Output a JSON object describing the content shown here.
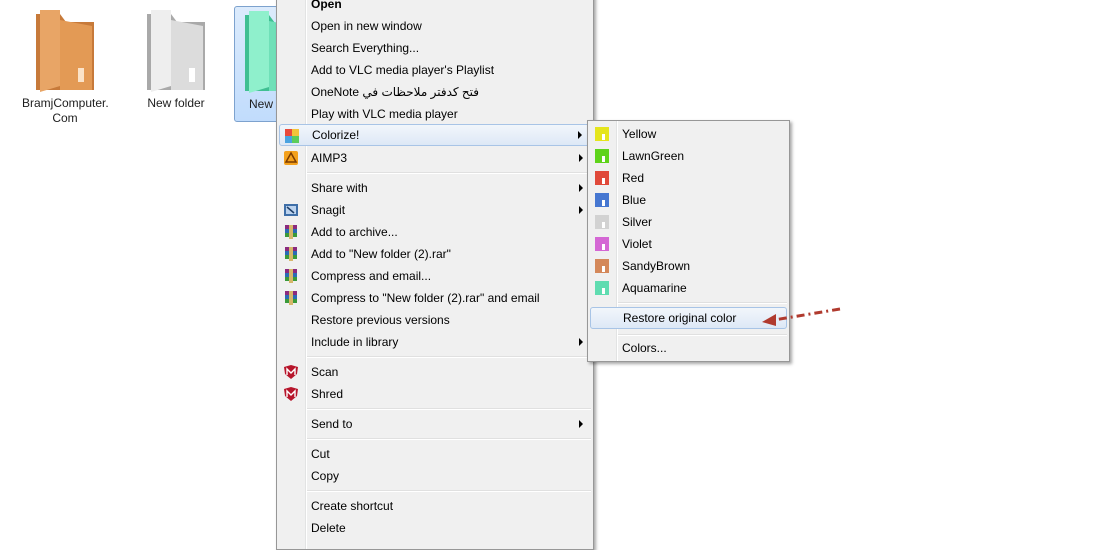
{
  "desktop": {
    "items": [
      {
        "label": "BramjComputer.\nCom",
        "color": "#d9904e"
      },
      {
        "label": "New folder",
        "color": "#d8d8d8"
      },
      {
        "label": "New",
        "color": "#6fe0b8"
      }
    ]
  },
  "context_menu": {
    "items": [
      {
        "label": "Open"
      },
      {
        "label": "Open in new window"
      },
      {
        "label": "Search Everything..."
      },
      {
        "label": "Add to VLC media player's Playlist"
      },
      {
        "label": "OneNote فتح كدفتر ملاحظات في"
      },
      {
        "label": "Play with VLC media player"
      },
      {
        "label": "Colorize!",
        "icon": "colorize-icon"
      },
      {
        "label": "AIMP3",
        "icon": "aimp-icon"
      },
      {
        "label": "Share with"
      },
      {
        "label": "Snagit",
        "icon": "snagit-icon"
      },
      {
        "label": "Add to archive...",
        "icon": "winrar-icon"
      },
      {
        "label": "Add to \"New folder (2).rar\"",
        "icon": "winrar-icon"
      },
      {
        "label": "Compress and email...",
        "icon": "winrar-icon"
      },
      {
        "label": "Compress to \"New folder (2).rar\" and email",
        "icon": "winrar-icon"
      },
      {
        "label": "Restore previous versions"
      },
      {
        "label": "Include in library"
      },
      {
        "label": "Scan",
        "icon": "mcafee-icon"
      },
      {
        "label": "Shred",
        "icon": "mcafee-icon"
      },
      {
        "label": "Send to"
      },
      {
        "label": "Cut"
      },
      {
        "label": "Copy"
      },
      {
        "label": "Create shortcut"
      },
      {
        "label": "Delete"
      }
    ]
  },
  "colorize_submenu": {
    "items": [
      {
        "label": "Yellow",
        "color": "#e5e51c"
      },
      {
        "label": "LawnGreen",
        "color": "#5ed31a"
      },
      {
        "label": "Red",
        "color": "#e0493a"
      },
      {
        "label": "Blue",
        "color": "#4677d1"
      },
      {
        "label": "Silver",
        "color": "#d2d2d2"
      },
      {
        "label": "Violet",
        "color": "#d467d4"
      },
      {
        "label": "SandyBrown",
        "color": "#d4885a"
      },
      {
        "label": "Aquamarine",
        "color": "#5fdcb0"
      },
      {
        "label": "Restore original color"
      },
      {
        "label": "Colors..."
      }
    ]
  },
  "annotation_arrow_color": "#b03a2e"
}
